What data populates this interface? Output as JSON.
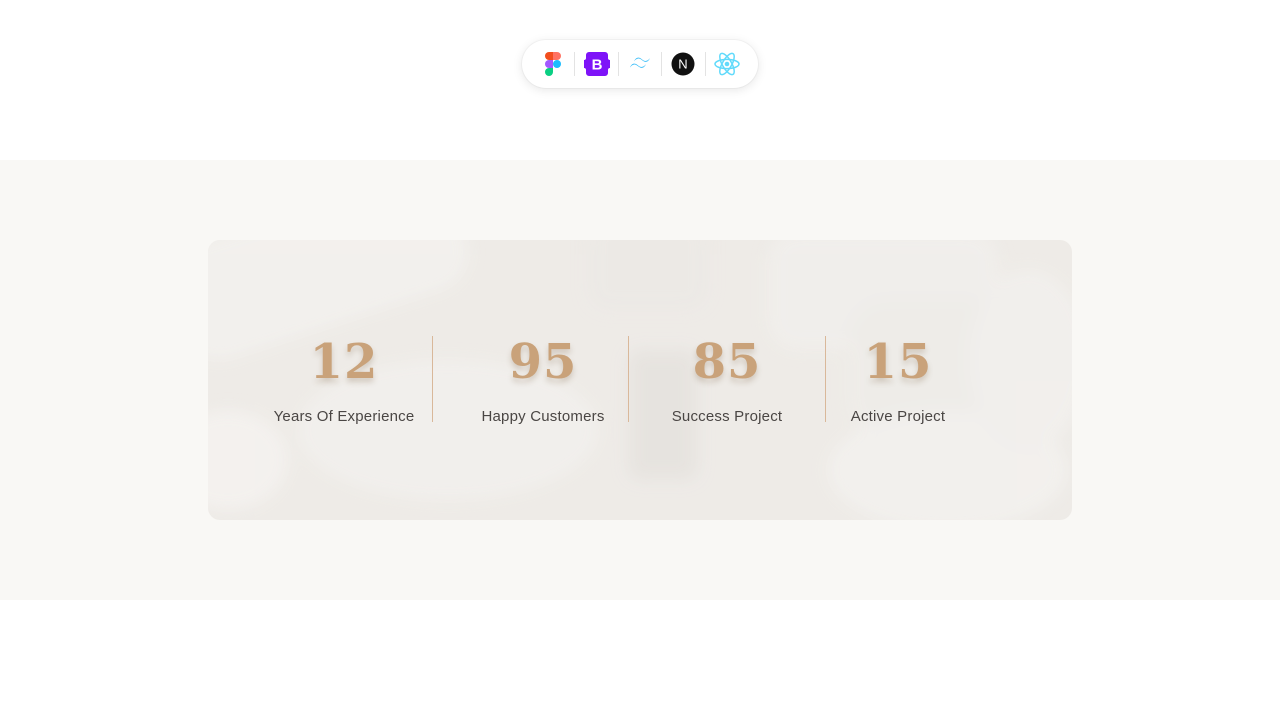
{
  "tech_stack": [
    {
      "icon": "figma-icon"
    },
    {
      "icon": "bootstrap-icon",
      "label": "B"
    },
    {
      "icon": "tailwind-icon"
    },
    {
      "icon": "nextjs-icon",
      "label": "N"
    },
    {
      "icon": "react-icon"
    }
  ],
  "stats": [
    {
      "value": "12",
      "label": "Years Of Experience"
    },
    {
      "value": "95",
      "label": "Happy Customers"
    },
    {
      "value": "85",
      "label": "Success Project"
    },
    {
      "value": "15",
      "label": "Active Project"
    }
  ],
  "colors": {
    "accent": "#c9a27a",
    "label_text": "#4a4644",
    "band_background": "#f9f8f5",
    "card_background": "#eeebe7",
    "bootstrap_purple": "#7e13f8",
    "tailwind_cyan": "#38bdf8",
    "react_cyan": "#61dafb"
  }
}
